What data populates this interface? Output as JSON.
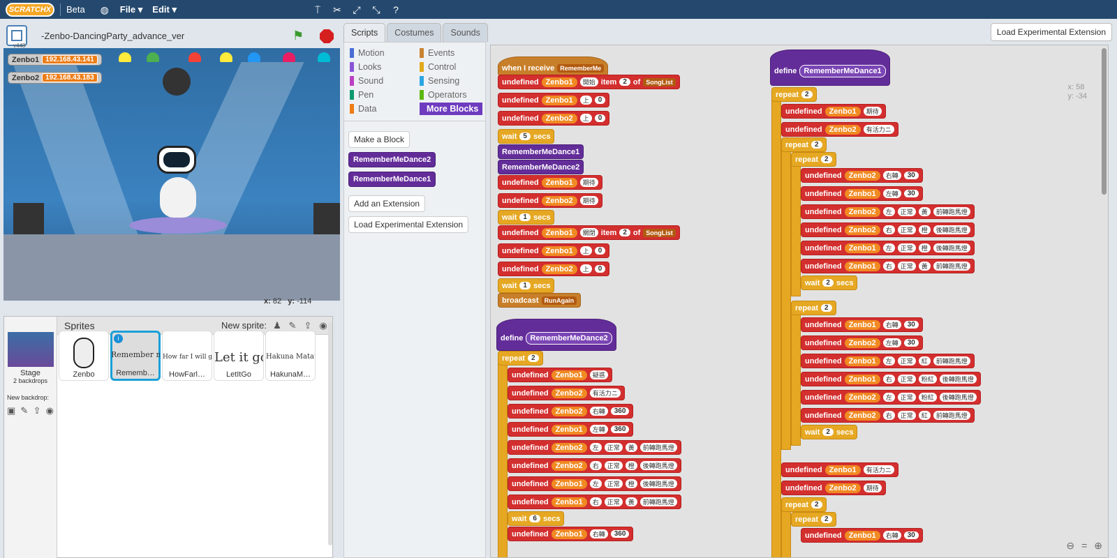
{
  "topbar": {
    "logo": "SCRATCHX",
    "beta": "Beta",
    "file": "File ▾",
    "edit": "Edit ▾"
  },
  "stage": {
    "version": "v448",
    "project_name": "-Zenbo-DancingParty_advance_ver",
    "monitors": [
      {
        "name": "Zenbo1",
        "value": "192.168.43.141"
      },
      {
        "name": "Zenbo2",
        "value": "192.168.43.183"
      }
    ],
    "x_label": "x:",
    "x": "82",
    "y_label": "y:",
    "y": "-114"
  },
  "sprites": {
    "title": "Sprites",
    "new_sprite": "New sprite:",
    "stage_label": "Stage",
    "backdrops": "2 backdrops",
    "new_backdrop": "New backdrop:",
    "items": [
      {
        "name": "Zenbo",
        "thumb": ""
      },
      {
        "name": "Rememb…",
        "thumb": "Remember me"
      },
      {
        "name": "HowFarl…",
        "thumb": "How far I will go"
      },
      {
        "name": "LetItGo",
        "thumb": "Let it go"
      },
      {
        "name": "HakunaM…",
        "thumb": "Hakuna Matata"
      }
    ]
  },
  "tabs": [
    "Scripts",
    "Costumes",
    "Sounds"
  ],
  "load_ext": "Load Experimental Extension",
  "palette": {
    "categories": [
      {
        "name": "Motion",
        "color": "#4a6cd4"
      },
      {
        "name": "Events",
        "color": "#c88330"
      },
      {
        "name": "Looks",
        "color": "#8a55d7"
      },
      {
        "name": "Control",
        "color": "#e1a91a"
      },
      {
        "name": "Sound",
        "color": "#bb42c3"
      },
      {
        "name": "Sensing",
        "color": "#2ca5e2"
      },
      {
        "name": "Pen",
        "color": "#0e9a6c"
      },
      {
        "name": "Operators",
        "color": "#5cb712"
      },
      {
        "name": "Data",
        "color": "#ee7d16"
      },
      {
        "name": "More Blocks",
        "color": "#632d99"
      }
    ],
    "make_block": "Make a Block",
    "blocks": [
      "RememberMeDance2",
      "RememberMeDance1"
    ],
    "add_extension": "Add an Extension",
    "load_extension": "Load Experimental Extension"
  },
  "scripts": {
    "u": "undefined",
    "z1": "Zenbo1",
    "z2": "Zenbo2",
    "when_receive": "when I receive",
    "remember_me": "RememberMe",
    "item": "item",
    "of": "of",
    "songlist": "SongList",
    "two": "2",
    "one": "1",
    "five": "5",
    "six": "6",
    "wait": "wait",
    "secs": "secs",
    "broadcast": "broadcast",
    "runagain": "RunAgain",
    "define": "define",
    "repeat": "repeat",
    "d1": "RememberMeDance1",
    "d2": "RememberMeDance2",
    "start": "開始",
    "close": "關閉",
    "up": "上",
    "zero": "0",
    "expect": "期待",
    "doubt": "疑惑",
    "energetic": "有活力ニ",
    "turn_r": "右轉",
    "turn_l": "左轉",
    "n30": "30",
    "n360": "360",
    "left": "左",
    "right": "右",
    "normal": "正常",
    "yellow": "黃",
    "orange": "橙",
    "red": "紅",
    "pink": "粉紅",
    "front_led": "前轉跑馬燈",
    "back_led": "後轉跑馬燈"
  },
  "script_coords": {
    "x": "x: 58",
    "y": "y: -34"
  },
  "zoom": [
    "zoom-out",
    "reset",
    "zoom-in"
  ]
}
